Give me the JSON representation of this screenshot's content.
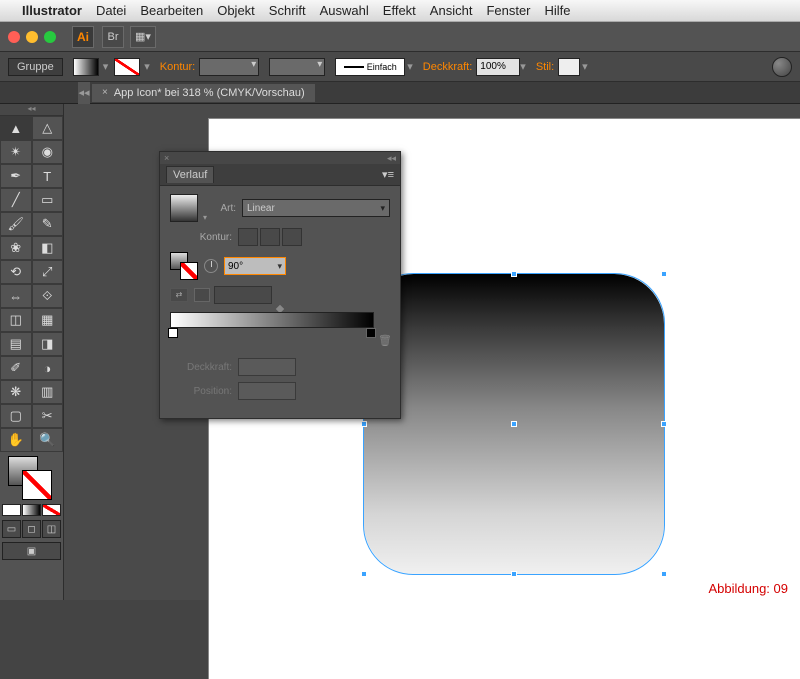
{
  "os_menu": {
    "app": "Illustrator",
    "items": [
      "Datei",
      "Bearbeiten",
      "Objekt",
      "Schrift",
      "Auswahl",
      "Effekt",
      "Ansicht",
      "Fenster",
      "Hilfe"
    ]
  },
  "app_logo": "Ai",
  "bridge_chip": "Br",
  "control_bar": {
    "group_label": "Gruppe",
    "kontur_label": "Kontur:",
    "stroke_style_label": "Einfach",
    "opacity_label": "Deckkraft:",
    "opacity_value": "100%",
    "style_label": "Stil:"
  },
  "doc_tab": "App Icon* bei 318 % (CMYK/Vorschau)",
  "panel": {
    "title": "Verlauf",
    "art_label": "Art:",
    "art_value": "Linear",
    "kontur_label": "Kontur:",
    "angle_value": "90°",
    "deckkraft_label": "Deckkraft:",
    "position_label": "Position:"
  },
  "caption": "Abbildung: 09",
  "chart_data": {
    "type": "area",
    "title": "Linear gradient fill on rounded rectangle",
    "angle_deg": 90,
    "stops": [
      {
        "position_pct": 0,
        "color": "#ffffff"
      },
      {
        "position_pct": 100,
        "color": "#000000"
      }
    ],
    "opacity_pct": 100
  }
}
